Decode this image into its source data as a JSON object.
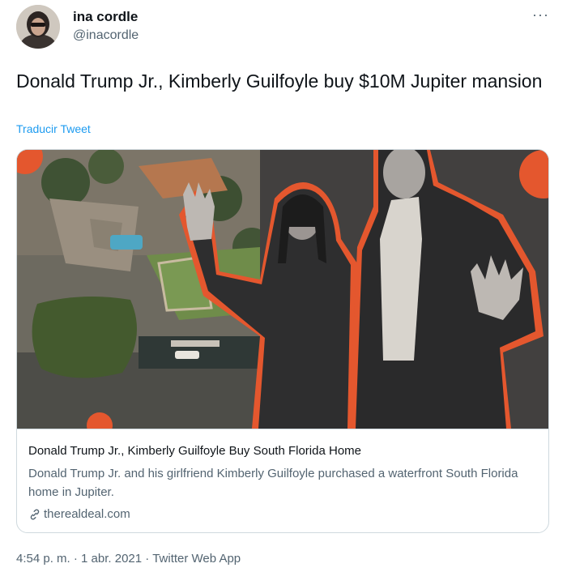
{
  "author": {
    "name": "ina cordle",
    "handle": "@inacordle",
    "avatar_icon": "profile-photo"
  },
  "menu": {
    "more_icon": "more-horizontal-icon",
    "more_label": "···"
  },
  "tweet": {
    "text": "Donald Trump Jr., Kimberly Guilfoyle buy $10M Jupiter mansion",
    "translate_label": "Traducir Tweet"
  },
  "card": {
    "image_description_icon": "article-collage-image",
    "title": "Donald Trump Jr., Kimberly Guilfoyle Buy South Florida Home",
    "description": "Donald Trump Jr. and his girlfriend Kimberly Guilfoyle purchased a waterfront South Florida home in Jupiter.",
    "domain": "therealdeal.com",
    "link_icon": "link-icon"
  },
  "footer": {
    "time": "4:54 p. m.",
    "separator": "·",
    "date": "1 abr. 2021",
    "client": "Twitter Web App"
  },
  "colors": {
    "link_blue": "#1d9bf0",
    "text_primary": "#0f1419",
    "text_secondary": "#536471",
    "accent_orange": "#e4572e",
    "card_border": "#cfd9de"
  }
}
